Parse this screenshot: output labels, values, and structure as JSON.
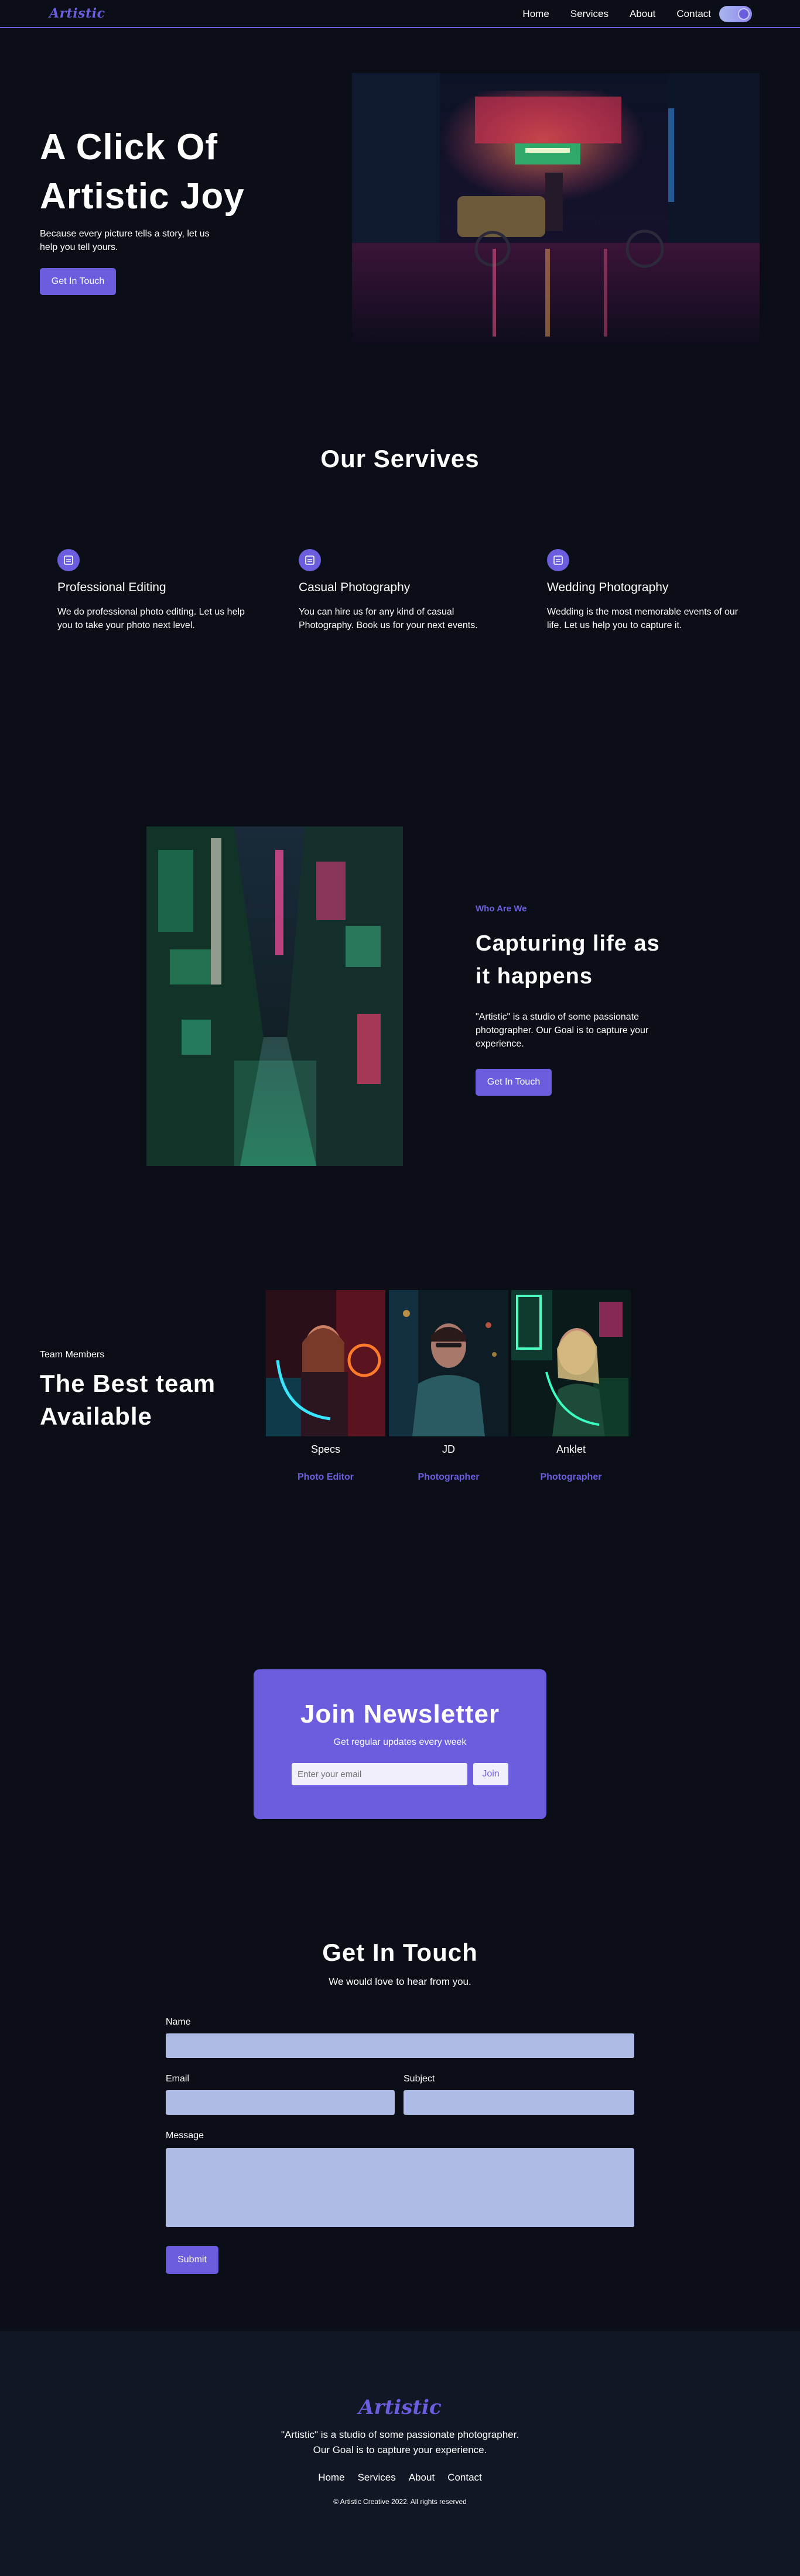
{
  "nav": {
    "logo": "Artistic",
    "links": [
      "Home",
      "Services",
      "About",
      "Contact"
    ]
  },
  "hero": {
    "title": "A Click Of Artistic Joy",
    "subtitle": "Because every picture tells a story, let us help you tell yours.",
    "button": "Get In Touch"
  },
  "services": {
    "title": "Our Servives",
    "items": [
      {
        "title": "Professional Editing",
        "desc": "We do professional photo editing. Let us help you to take your photo next level."
      },
      {
        "title": "Casual Photography",
        "desc": "You can hire us for any kind of casual Photography. Book us for your next events."
      },
      {
        "title": "Wedding Photography",
        "desc": "Wedding is the most memorable events of our life. Let us help you to capture it."
      }
    ]
  },
  "about": {
    "kicker": "Who Are We",
    "title": "Capturing life as it happens",
    "desc": "\"Artistic\" is a studio of some passionate photographer. Our Goal is to capture your experience.",
    "button": "Get In Touch"
  },
  "team": {
    "kicker": "Team Members",
    "title": "The Best team Available",
    "members": [
      {
        "name": "Specs",
        "role": "Photo Editor"
      },
      {
        "name": "JD",
        "role": "Photographer"
      },
      {
        "name": "Anklet",
        "role": "Photographer"
      }
    ]
  },
  "newsletter": {
    "title": "Join Newsletter",
    "subtitle": "Get regular updates every week",
    "placeholder": "Enter your email",
    "button": "Join"
  },
  "contact": {
    "title": "Get In Touch",
    "subtitle": "We would love to hear from you.",
    "name_label": "Name",
    "email_label": "Email",
    "subject_label": "Subject",
    "message_label": "Message",
    "submit": "Submit"
  },
  "footer": {
    "logo": "Artistic",
    "desc": "\"Artistic\" is a studio of some passionate photographer. Our Goal is to capture your experience.",
    "links": [
      "Home",
      "Services",
      "About",
      "Contact"
    ],
    "copyright": "© Artistic Creative 2022. All rights reserved"
  },
  "colors": {
    "accent": "#6c5ddf",
    "background": "#0b0e17",
    "footer_bg": "#121726",
    "input_bg": "#aebbe6"
  }
}
